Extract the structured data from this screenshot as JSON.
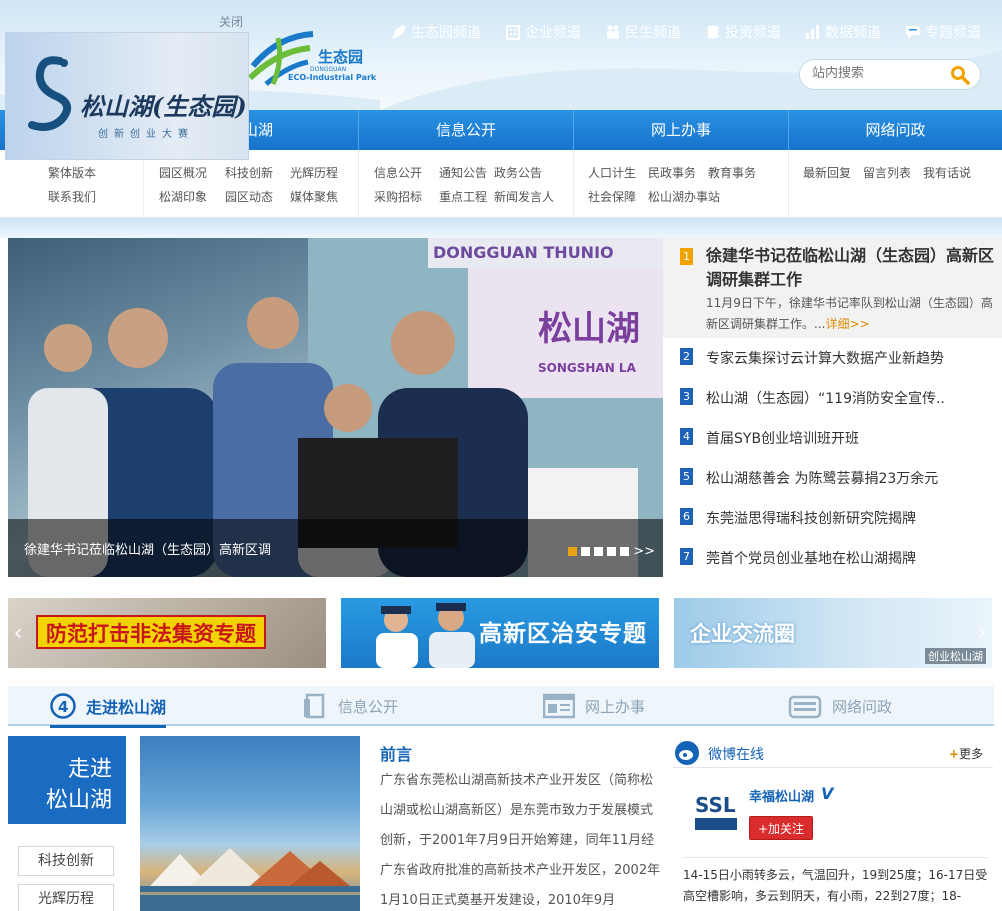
{
  "header": {
    "close_label": "关闭",
    "ad_logo_text": "松山湖(生态园)",
    "ad_logo_sub": "创新创业大赛",
    "park_logo_cn": "生态园",
    "park_logo_en1": "DONGGUAN",
    "park_logo_en2": "ECO-Industrial Park",
    "channels": [
      "生态园频道",
      "企业频道",
      "民生频道",
      "投资频道",
      "数据频道",
      "专题频道"
    ],
    "search_placeholder": "站内搜索"
  },
  "nav": {
    "tabs": [
      "松山湖",
      "信息公开",
      "网上办事",
      "网络问政"
    ],
    "col0": [
      "繁体版本",
      "联系我们"
    ],
    "col1": [
      "园区概况",
      "科技创新",
      "光辉历程",
      "松湖印象",
      "园区动态",
      "媒体聚焦"
    ],
    "col2": [
      "信息公开",
      "通知公告",
      "政务公告",
      "采购招标",
      "重点工程",
      "新闻发言人"
    ],
    "col3": [
      "人口计生",
      "民政事务",
      "教育事务",
      "社会保障",
      "松山湖办事站"
    ],
    "col4": [
      "最新回复",
      "留言列表",
      "我有话说"
    ]
  },
  "slideshow": {
    "caption": "徐建华书记莅临松山湖（生态园）高新区调",
    "sign_top": "DONGGUAN THUNIO",
    "sign_mid": "松山湖",
    "sign_bot": "SONGSHAN LA",
    "dots": 5,
    "active_dot": 0
  },
  "news": {
    "headline": {
      "num": "1",
      "title": "徐建华书记莅临松山湖（生态园）高新区调研集群工作",
      "desc": "11月9日下午，徐建华书记率队到松山湖（生态园）高新区调研集群工作。...",
      "more": "详细>>"
    },
    "items": [
      {
        "num": "2",
        "title": "专家云集探讨云计算大数据产业新趋势"
      },
      {
        "num": "3",
        "title": "松山湖（生态园）“119消防安全宣传.."
      },
      {
        "num": "4",
        "title": "首届SYB创业培训班开班"
      },
      {
        "num": "5",
        "title": "松山湖慈善会 为陈鹭芸募捐23万余元"
      },
      {
        "num": "6",
        "title": "东莞溢思得瑞科技创新研究院揭牌"
      },
      {
        "num": "7",
        "title": "莞首个党员创业基地在松山湖揭牌"
      }
    ]
  },
  "ads": {
    "ad1": "防范打击非法集资专题",
    "ad2": "高新区治安专题",
    "ad3": "企业交流圈",
    "ad3_corner": "创业松山湖"
  },
  "sections": {
    "tabs": [
      "走进松山湖",
      "信息公开",
      "网上办事",
      "网络问政"
    ]
  },
  "intro": {
    "box_line1": "走进",
    "box_line2": "松山湖",
    "links": [
      "科技创新",
      "光辉历程"
    ],
    "preface_title": "前言",
    "preface_text": "广东省东莞松山湖高新技术产业开发区（简称松山湖或松山湖高新区）是东莞市致力于发展模式创新，于2001年7月9日开始筹建，同年11月经广东省政府批准的高新技术产业开发区，2002年1月10日正式奠基开发建设，2010年9月"
  },
  "weibo": {
    "title": "微博在线",
    "more": "更多",
    "name": "幸福松山湖",
    "follow": "+加关注",
    "text": "14-15日小雨转多云，气温回升，19到25度；16-17日受高空槽影响，多云到阴天，有小雨，22到27度；18-"
  },
  "colors": {
    "nav_blue": "#1673cc",
    "accent_orange": "#f0a300",
    "num_blue": "#1e63b8",
    "follow_red": "#d92c2c"
  }
}
